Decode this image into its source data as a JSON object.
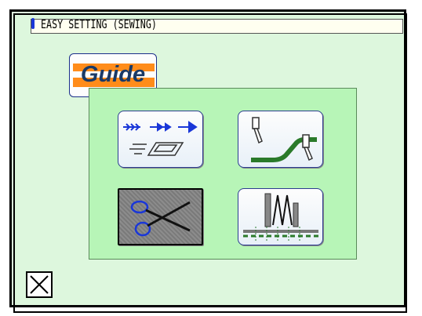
{
  "header": {
    "title": "EASY SETTING (SEWING)"
  },
  "guide": {
    "label": "Guide"
  },
  "menu": {
    "items": [
      {
        "icon": "feed-pattern-icon"
      },
      {
        "icon": "presser-height-icon"
      },
      {
        "icon": "scissors-icon",
        "selected": true
      },
      {
        "icon": "thread-tension-icon"
      }
    ]
  },
  "footer": {
    "close_icon": "close-icon"
  },
  "colors": {
    "background": "#ddf7dd",
    "panel": "#b7f5b7",
    "accent": "#ff8c1a",
    "icon_blue": "#1a37d8",
    "icon_green": "#2a7a2a"
  }
}
